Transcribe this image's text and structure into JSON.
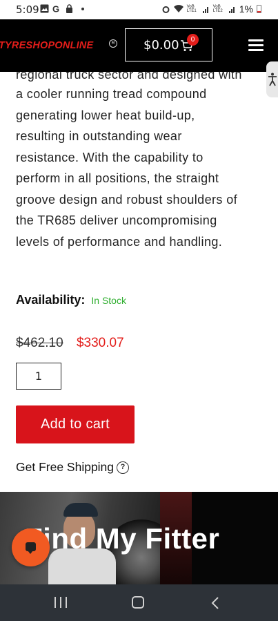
{
  "status_bar": {
    "time": "5:09",
    "battery": "1%",
    "icons": [
      "gallery-icon",
      "google-icon",
      "lock-icon",
      "alarm-icon",
      "wifi-icon",
      "signal-lte1-icon",
      "signal-lte2-icon",
      "battery-icon"
    ],
    "lte1": "VoB LTE1",
    "lte2": "VoB LTE2"
  },
  "header": {
    "logo_text": "TYRESHOPONLINE",
    "cart_total": "$0.00",
    "cart_count": "0",
    "brand_color": "#e31d1a"
  },
  "description": {
    "clipped_line": "regional truck sector and designed with",
    "lines": [
      "a cooler running tread compound",
      "generating lower heat build-up,",
      "resulting in outstanding wear",
      "resistance. With the capability to",
      "perform in all positions, the straight",
      "groove design and robust shoulders of",
      "the TR685 deliver uncompromising",
      "levels of performance and handling."
    ]
  },
  "availability": {
    "label": "Availability:",
    "status": "In Stock",
    "status_color": "#2fae2f"
  },
  "price": {
    "original": "$462.10",
    "sale": "$330.07",
    "sale_color": "#e31d1a"
  },
  "quantity": "1",
  "add_to_cart_label": "Add to cart",
  "shipping": {
    "label": "Get Free Shipping",
    "help": "?"
  },
  "fitter_banner": {
    "title": "Find My Fitter"
  },
  "nav": {
    "recent": "recent-apps-icon",
    "home": "home-icon",
    "back": "back-icon"
  }
}
